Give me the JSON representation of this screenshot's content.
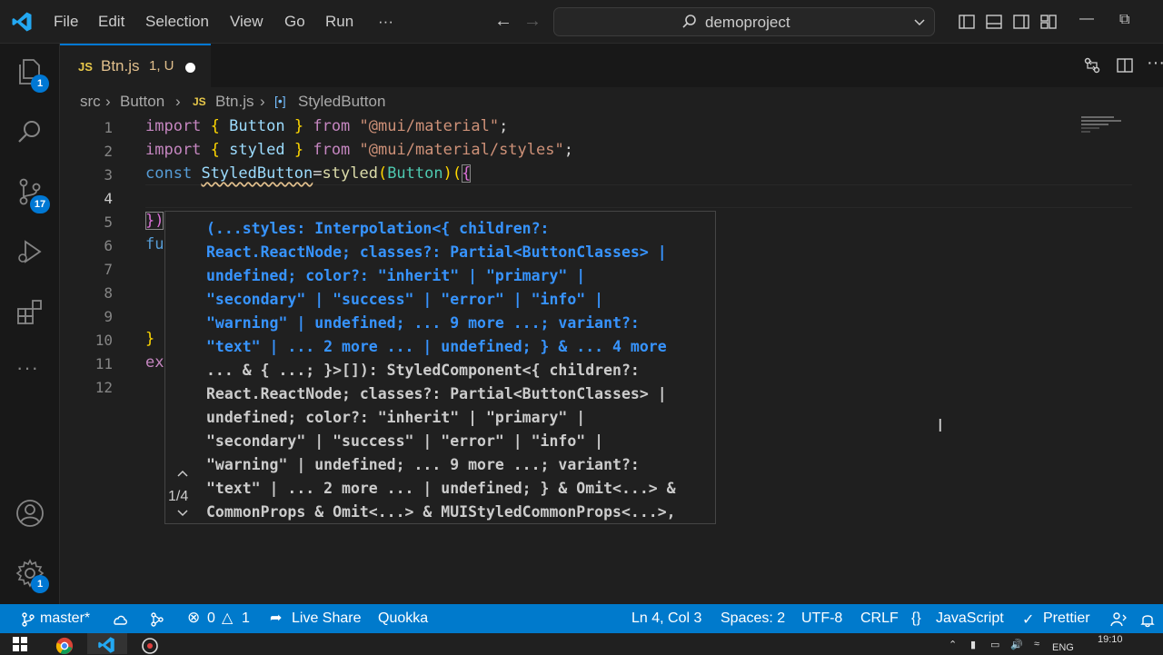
{
  "menu": {
    "items": [
      "File",
      "Edit",
      "Selection",
      "View",
      "Go",
      "Run",
      "···"
    ]
  },
  "search": {
    "text": "demoproject"
  },
  "activity": {
    "explorer_badge": "1",
    "scm_badge": "17",
    "settings_badge": "1"
  },
  "tab": {
    "icon": "JS",
    "name": "Btn.js",
    "status": "1, U"
  },
  "breadcrumb": {
    "items": [
      "src",
      "Button",
      "Btn.js",
      "StyledButton"
    ],
    "js_icon": "JS"
  },
  "editor": {
    "line_numbers": [
      "1",
      "2",
      "3",
      "4",
      "5",
      "6",
      "7",
      "8",
      "9",
      "10",
      "11",
      "12"
    ],
    "line5_fragment": "})",
    "line6_fragment": "fu",
    "line10_fragment": "}",
    "line11_fragment": "ex"
  },
  "hover": {
    "counter": "1/4",
    "lines": [
      "(...styles: Interpolation<{ children?:",
      "React.ReactNode; classes?: Partial<ButtonClasses> |",
      "undefined; color?: \"inherit\" | \"primary\" |",
      "\"secondary\" | \"success\" | \"error\" | \"info\" |",
      "\"warning\" | undefined; ... 9 more ...; variant?:",
      "\"text\" | ... 2 more ... | undefined; } & ... 4 more",
      "... & { ...; }>[]): StyledComponent<{ children?:",
      "React.ReactNode; classes?: Partial<ButtonClasses> |",
      "undefined; color?: \"inherit\" | \"primary\" |",
      "\"secondary\" | \"success\" | \"error\" | \"info\" |",
      "\"warning\" | undefined; ... 9 more ...; variant?:",
      "\"text\" | ... 2 more ... | undefined; } & Omit<...> &",
      "CommonProps & Omit<...> & MUIStyledCommonProps<...>,"
    ]
  },
  "status": {
    "branch": "master*",
    "errors": "0",
    "warnings": "1",
    "live_share": "Live Share",
    "quokka": "Quokka",
    "position": "Ln 4, Col 3",
    "spaces": "Spaces: 2",
    "encoding": "UTF-8",
    "eol": "CRLF",
    "language": "JavaScript",
    "prettier": "Prettier"
  },
  "taskbar": {
    "lang": "ENG",
    "time": "19:10"
  },
  "colors": {
    "accent": "#0078d4",
    "statusbar": "#007acc",
    "modified": "#e2c08d"
  }
}
